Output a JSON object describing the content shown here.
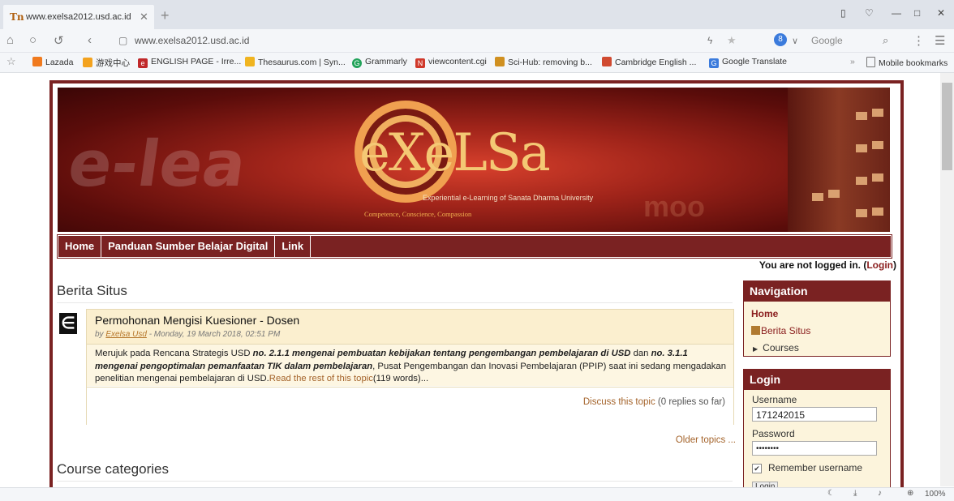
{
  "browser": {
    "tab_title": "www.exelsa2012.usd.ac.id",
    "url": "www.exelsa2012.usd.ac.id",
    "search_engine": "Google",
    "zoom": "100%",
    "bookmarks": [
      {
        "label": "Lazada",
        "color": "#f07a1e"
      },
      {
        "label": "游戏中心",
        "color": "#f3a21e"
      },
      {
        "label": "ENGLISH PAGE - Irre...",
        "color": "#c0282a"
      },
      {
        "label": "Thesaurus.com | Syn...",
        "color": "#f0b420"
      },
      {
        "label": "Grammarly",
        "color": "#22a35a"
      },
      {
        "label": "viewcontent.cgi",
        "color": "#d0392b"
      },
      {
        "label": "Sci-Hub: removing b...",
        "color": "#d09020"
      },
      {
        "label": "Cambridge English ...",
        "color": "#d04a30"
      },
      {
        "label": "Google Translate",
        "color": "#3b7bdc"
      }
    ],
    "mobile_bookmarks": "Mobile bookmarks"
  },
  "banner": {
    "logo_text": "eXeLSa",
    "subtitle": "Experiential e-Learning of Sanata Dharma University",
    "motto": "Competence, Conscience, Compassion"
  },
  "menu": [
    {
      "label": "Home"
    },
    {
      "label": "Panduan Sumber Belajar Digital"
    },
    {
      "label": "Link"
    }
  ],
  "login_status": {
    "text": "You are not logged in. (",
    "link": "Login",
    "close": ")"
  },
  "news": {
    "heading": "Berita Situs",
    "post": {
      "title": "Permohonan Mengisi Kuesioner - Dosen",
      "by": "by ",
      "author": "Exelsa Usd",
      "date": " - Monday, 19 March 2018, 02:51 PM",
      "body_1": "Merujuk pada Rencana Strategis USD ",
      "body_b1": "no. 2.1.1 mengenai pembuatan kebijakan tentang pengembangan pembelajaran di USD",
      "body_2": " dan ",
      "body_b2": "no. 3.1.1 mengenai pengoptimalan pemanfaatan TIK dalam pembelajaran",
      "body_3": ", Pusat Pengembangan dan Inovasi Pembelajaran (PPIP) saat ini sedang mengadakan penelitian mengenai pembelajaran di USD.",
      "read_more": "Read the rest of this topic",
      "word_count": "(119 words)...",
      "discuss": "Discuss this topic",
      "replies": " (0 replies so far)"
    },
    "older": "Older topics ..."
  },
  "course_categories": {
    "heading": "Course categories"
  },
  "navigation_block": {
    "title": "Navigation",
    "home": "Home",
    "site_news": "Berita Situs",
    "courses": "Courses"
  },
  "login_block": {
    "title": "Login",
    "username_label": "Username",
    "username_value": "171242015",
    "password_label": "Password",
    "password_value": "••••••••",
    "remember": "Remember username",
    "button": "Login"
  }
}
